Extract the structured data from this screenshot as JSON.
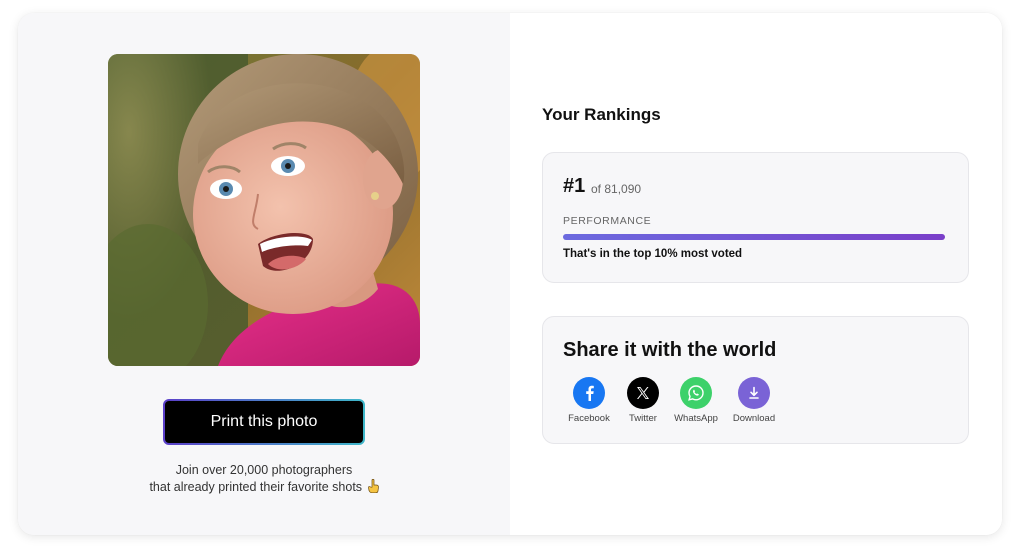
{
  "print_button": {
    "label": "Print this photo"
  },
  "join": {
    "line1": "Join over 20,000 photographers",
    "line2": "that already printed their favorite shots"
  },
  "rankings": {
    "title": "Your Rankings",
    "rank": "#1",
    "of_total": "of 81,090",
    "performance_label": "PERFORMANCE",
    "performance_fraction": 1.0,
    "performance_text": "That's in the top 10% most voted"
  },
  "share": {
    "title": "Share it with the world",
    "items": [
      {
        "label": "Facebook",
        "icon": "facebook-icon",
        "color": "#1877f2"
      },
      {
        "label": "Twitter",
        "icon": "x-icon",
        "color": "#000000"
      },
      {
        "label": "WhatsApp",
        "icon": "whatsapp-icon",
        "color": "#3dd16a"
      },
      {
        "label": "Download",
        "icon": "download-icon",
        "color": "#7a63d6"
      }
    ]
  },
  "colors": {
    "accent": "#6c6adf",
    "panel_bg": "#f7f7f9"
  }
}
